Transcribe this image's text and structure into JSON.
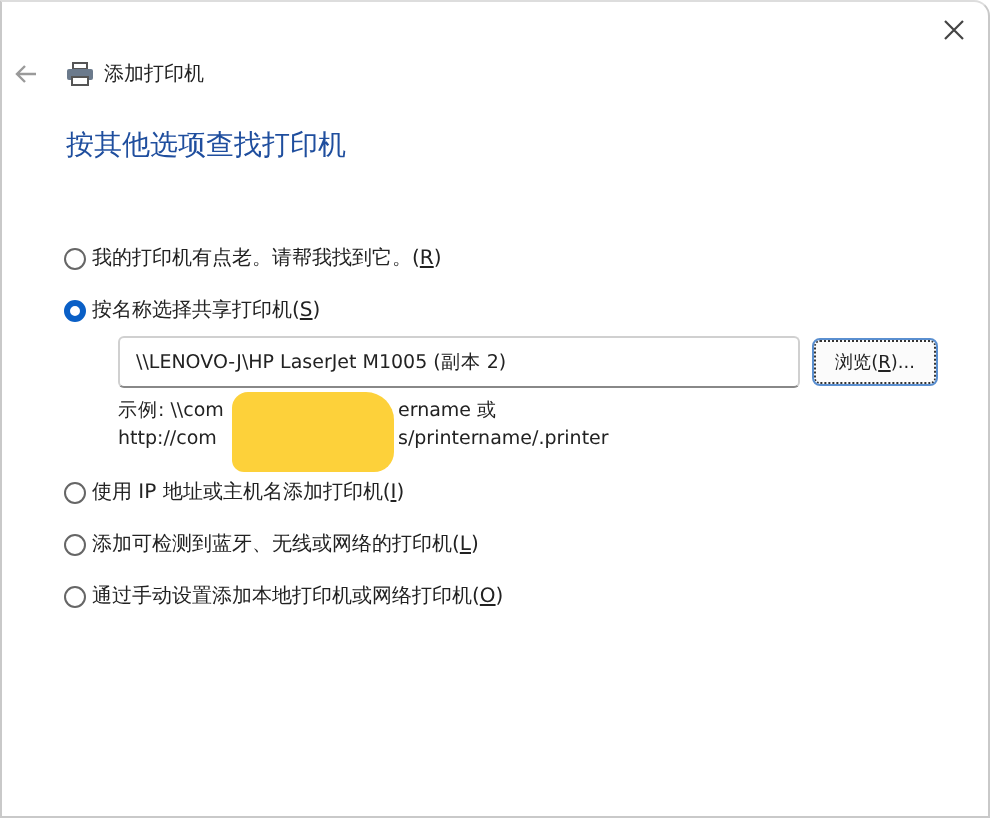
{
  "window": {
    "title": "添加打印机"
  },
  "heading": "按其他选项查找打印机",
  "options": [
    {
      "label_before": "我的打印机有点老。请帮我找到它。(",
      "key": "R",
      "label_after": ")",
      "selected": false
    },
    {
      "label_before": "按名称选择共享打印机(",
      "key": "S",
      "label_after": ")",
      "selected": true
    },
    {
      "label_before": "使用 IP 地址或主机名添加打印机(",
      "key": "I",
      "label_after": ")",
      "selected": false
    },
    {
      "label_before": "添加可检测到蓝牙、无线或网络的打印机(",
      "key": "L",
      "label_after": ")",
      "selected": false
    },
    {
      "label_before": "通过手动设置添加本地打印机或网络打印机(",
      "key": "O",
      "label_after": ")",
      "selected": false
    }
  ],
  "shared_printer": {
    "value": "\\\\LENOVO-J\\HP LaserJet M1005 (副本 2)",
    "browse_button": {
      "label_before": "浏览(",
      "key": "R",
      "label_after": ")..."
    },
    "example_lines": [
      [
        "示例: \\\\com",
        "ername 或"
      ],
      [
        "http://com",
        "s/printername/.printer"
      ]
    ]
  }
}
